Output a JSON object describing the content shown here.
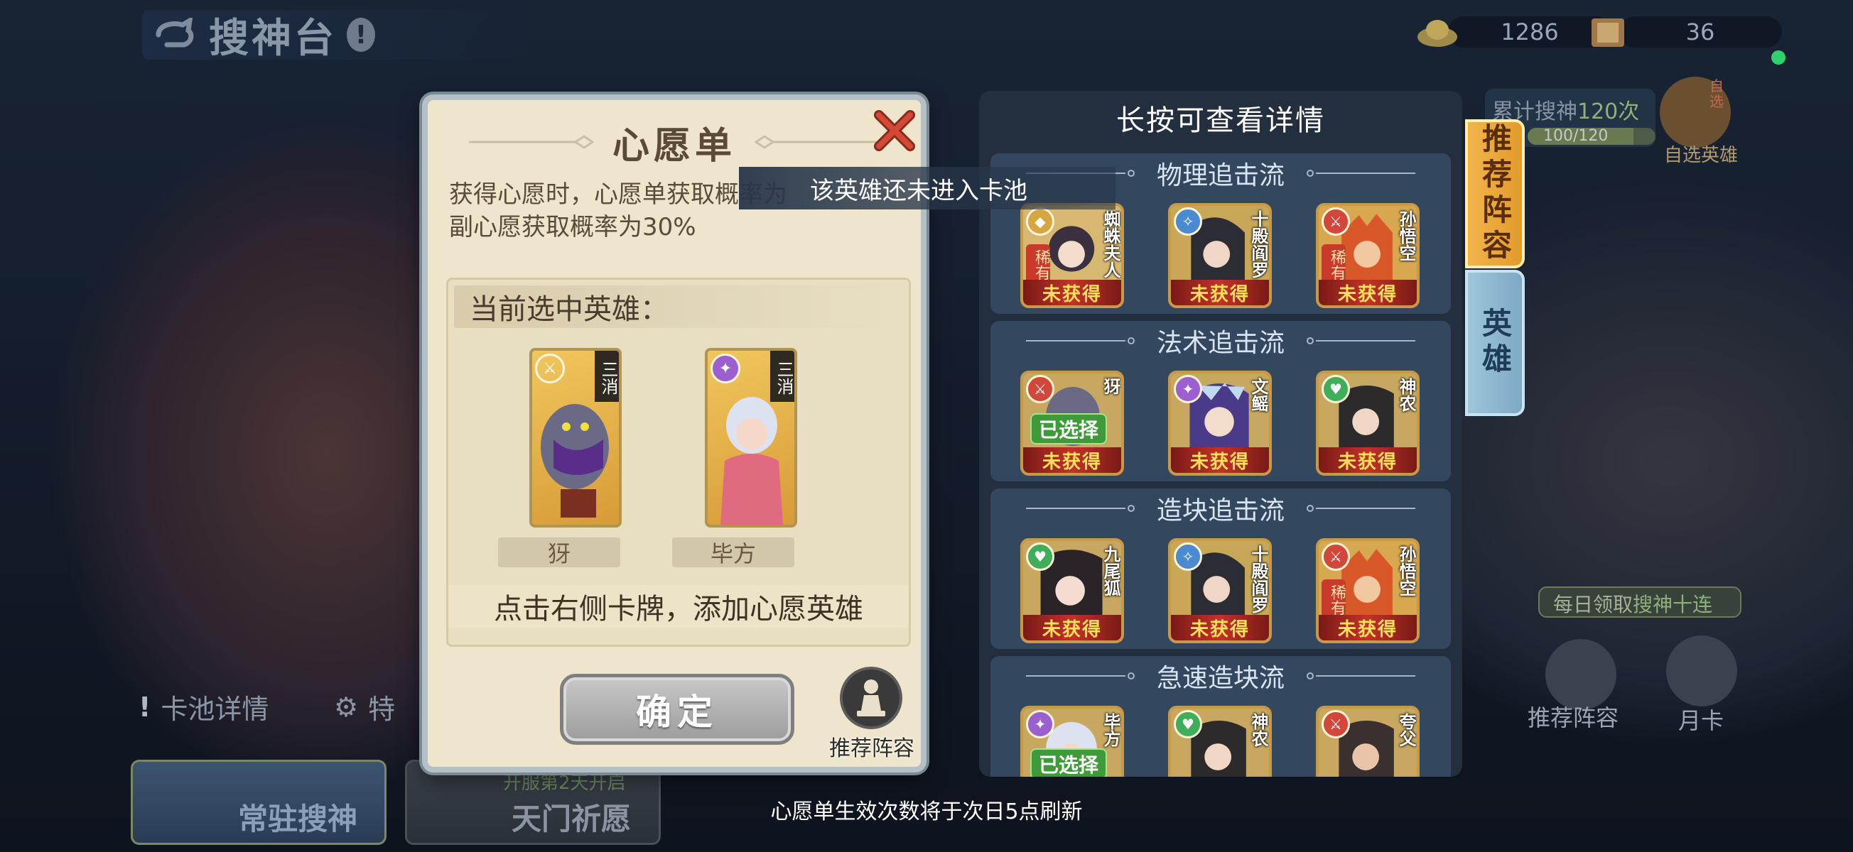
{
  "topbar": {
    "title": "搜神台",
    "gold": "1286",
    "scroll": "36"
  },
  "background": {
    "cumulative_label": "累计搜神",
    "cumulative_count": "120次",
    "progress_text": "100/120",
    "progress_fraction": 0.833,
    "self_select_label": "自选英雄",
    "self_select_tag": "自选",
    "daily_label": "每日领取",
    "daily_highlight": "搜神十连",
    "rec_lineup_label": "推荐阵容",
    "monthly_card_label": "月卡",
    "card_pool_label": "卡池详情",
    "special_label": "特",
    "pool_tab_1": "常驻搜神",
    "pool_tab_2": "天门祈愿",
    "pool_tab_2_note": "开服第2天开启"
  },
  "wish_panel": {
    "title": "心愿单",
    "desc_line1": "获得心愿时，心愿单获取概率为",
    "desc_line2": "副心愿获取概率为30%",
    "current_heading": "当前选中英雄：",
    "selected_heroes": [
      {
        "name": "犽",
        "tag": "三消",
        "badge_color": "#d3473a"
      },
      {
        "name": "毕方",
        "tag": "三消",
        "badge_color": "#9b5fd0"
      }
    ],
    "hint": "点击右侧卡牌，添加心愿英雄",
    "confirm_label": "确定",
    "recommend_label": "推荐阵容"
  },
  "tooltip": "该英雄还未进入卡池",
  "list_panel": {
    "title": "长按可查看详情",
    "groups": [
      {
        "name": "物理追击流",
        "heroes": [
          {
            "name": "蜘蛛夫人",
            "rarity": "稀有",
            "status": "未获得",
            "badge_color": "#d8a640"
          },
          {
            "name": "十殿阎罗",
            "rarity": "",
            "status": "未获得",
            "badge_color": "#4a8ad0"
          },
          {
            "name": "孙悟空",
            "rarity": "稀有",
            "status": "未获得",
            "badge_color": "#d3473a"
          }
        ]
      },
      {
        "name": "法术追击流",
        "heroes": [
          {
            "name": "犽",
            "chosen": "已选择",
            "status": "未获得",
            "badge_color": "#d3473a"
          },
          {
            "name": "文鳐",
            "status": "未获得",
            "badge_color": "#9b5fd0"
          },
          {
            "name": "神农",
            "status": "未获得",
            "badge_color": "#3fae5a"
          }
        ]
      },
      {
        "name": "造块追击流",
        "heroes": [
          {
            "name": "九尾狐",
            "status": "未获得",
            "badge_color": "#3fae5a"
          },
          {
            "name": "十殿阎罗",
            "status": "未获得",
            "badge_color": "#4a8ad0"
          },
          {
            "name": "孙悟空",
            "rarity": "稀有",
            "status": "未获得",
            "badge_color": "#d3473a"
          }
        ]
      },
      {
        "name": "急速造块流",
        "heroes": [
          {
            "name": "毕方",
            "chosen": "已选择",
            "badge_color": "#9b5fd0"
          },
          {
            "name": "神农",
            "badge_color": "#3fae5a"
          },
          {
            "name": "夸父",
            "badge_color": "#d3473a"
          }
        ]
      }
    ]
  },
  "side_tabs": [
    "推荐阵容",
    "英雄"
  ],
  "refresh_note": "心愿单生效次数将于次日5点刷新"
}
